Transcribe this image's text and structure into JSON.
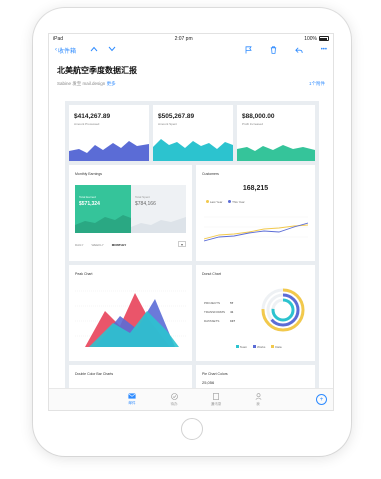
{
  "status": {
    "carrier": "iPad",
    "time": "2:07 pm",
    "battery": "100%"
  },
  "nav": {
    "back_label": "收件箱"
  },
  "email": {
    "title": "北美航空季度数据汇报",
    "sender": "Sabine",
    "sender_tag": "发至",
    "recipient": "mail.design",
    "more_link": "更多",
    "attachment": "1个附件"
  },
  "kpis": [
    {
      "value": "$414,267.89",
      "label": "Amount Processed",
      "color": "#5b6cd6"
    },
    {
      "value": "$505,267.89",
      "label": "Amount Spent",
      "color": "#2cc3cf"
    },
    {
      "value": "$88,000.00",
      "label": "Profit Increased",
      "color": "#35c49a"
    }
  ],
  "earnings": {
    "title": "Monthly Earnings",
    "total_earned_label": "Total Earned",
    "total_earned_value": "$571,324",
    "total_spent_label": "Total Spent",
    "total_spent_value": "$784,166",
    "options": [
      "DAILY",
      "WEEKLY",
      "MONTHLY"
    ],
    "selected": "MONTHLY"
  },
  "customers": {
    "title": "Customers",
    "value": "168,215",
    "legend": [
      "Last Year",
      "This Year"
    ]
  },
  "peak": {
    "title": "Peak Chart"
  },
  "donut": {
    "title": "Donut Chart",
    "rows": [
      {
        "label": "PROJECTS",
        "value": "57"
      },
      {
        "label": "TRANSFORMS",
        "value": "41"
      },
      {
        "label": "DATASETS",
        "value": "107"
      }
    ],
    "legend": [
      "Team",
      "Works",
      "Data"
    ]
  },
  "bottom_cards": [
    {
      "title": "Double Color Bar Charts"
    },
    {
      "title": "Pie Chart Colors",
      "value": "25,056"
    }
  ],
  "tabs": [
    {
      "label": "邮件",
      "icon": "mail-icon",
      "active": true
    },
    {
      "label": "待办",
      "icon": "todo-icon",
      "active": false
    },
    {
      "label": "通讯录",
      "icon": "contacts-icon",
      "active": false
    },
    {
      "label": "我",
      "icon": "profile-icon",
      "active": false
    }
  ],
  "colors": {
    "accent": "#2e8bff",
    "indigo": "#5b6cd6",
    "teal": "#2cc3cf",
    "green": "#35c49a",
    "red": "#e8435a",
    "yellow": "#f2c94c"
  }
}
